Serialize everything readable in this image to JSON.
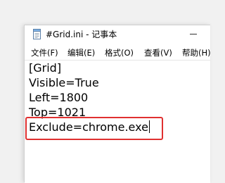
{
  "window": {
    "title": "#Grid.ini - 记事本",
    "app_icon": "notepad-icon"
  },
  "menubar": {
    "items": [
      {
        "label": "文件(F)"
      },
      {
        "label": "编辑(E)"
      },
      {
        "label": "格式(O)"
      },
      {
        "label": "查看(V)"
      },
      {
        "label": "帮助(H)"
      }
    ]
  },
  "editor": {
    "lines": [
      "[Grid]",
      "Visible=True",
      "Left=1800",
      "Top=1021",
      "Exclude=chrome.exe"
    ]
  },
  "annotation": {
    "highlight_color": "#e03030"
  }
}
